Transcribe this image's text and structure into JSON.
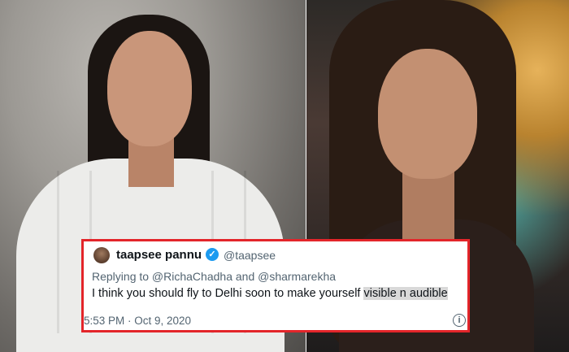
{
  "tweet": {
    "display_name": "taapsee pannu",
    "handle": "@taapsee",
    "reply_line": "Replying to @RichaChadha and @sharmarekha",
    "body_plain": "I think you should fly to Delhi soon to make yourself ",
    "body_highlight": "visible n audible",
    "timestamp": "5:53 PM · Oct 9, 2020",
    "verified_icon": "verified-badge-icon",
    "info_icon": "info-icon"
  },
  "colors": {
    "frame_border": "#e3252a",
    "verified": "#1d9bf0",
    "secondary_text": "#536471"
  }
}
